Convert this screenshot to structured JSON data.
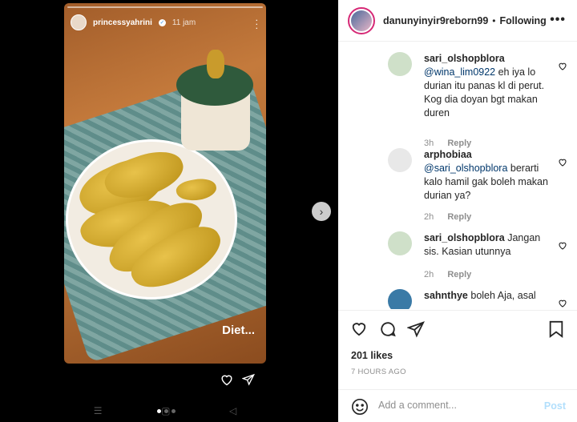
{
  "story": {
    "username": "princessyahrini",
    "time": "11 jam",
    "caption": "Diet...",
    "heart_icon": "heart-icon",
    "send_icon": "send-icon"
  },
  "header": {
    "username": "danunyinyir9reborn99",
    "dot": "•",
    "follow_status": "Following",
    "more": "•••"
  },
  "comments": [
    {
      "username": "sari_olshopblora",
      "mention": "@wina_lim0922",
      "text": " eh iya lo durian itu panas kl di perut. Kog dia doyan bgt makan duren",
      "time": "3h",
      "reply": "Reply",
      "avatar_color": "#cfe0c9"
    },
    {
      "username": "arphobiaa",
      "mention": "@sari_olshopblora",
      "text": " berarti kalo hamil gak boleh makan durian ya?",
      "time": "2h",
      "reply": "Reply",
      "avatar_color": "#dbdbdb"
    },
    {
      "username": "sari_olshopblora",
      "mention": "",
      "text": " Jangan sis. Kasian utunnya",
      "time": "2h",
      "reply": "Reply",
      "avatar_color": "#cfe0c9"
    },
    {
      "username": "sahnthye",
      "mention": "",
      "text": " boleh Aja, asal",
      "time": "",
      "reply": "",
      "avatar_color": "#3a7aa6"
    }
  ],
  "actions": {
    "likes": "201 likes",
    "time_ago": "7 HOURS AGO"
  },
  "add_comment": {
    "placeholder": "Add a comment...",
    "post_label": "Post"
  },
  "colors": {
    "link": "#00376b",
    "muted": "#8e8e8e",
    "post_disabled": "#b2dffc"
  }
}
